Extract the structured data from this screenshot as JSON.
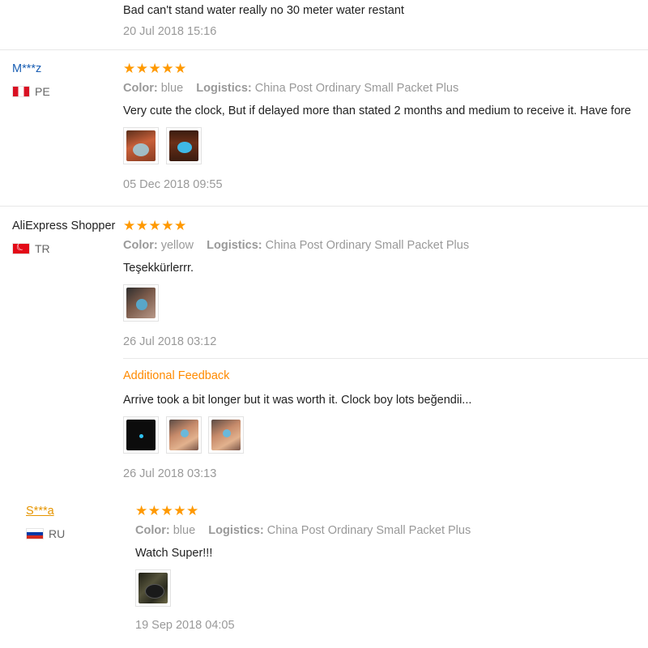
{
  "top_review": {
    "text": "Bad can't stand water really no 30 meter water restant",
    "date": "20 Jul 2018 15:16"
  },
  "reviews": [
    {
      "name": "M***z",
      "country_code": "PE",
      "stars": "★★★★★",
      "color_label": "Color:",
      "color_value": "blue",
      "logistics_label": "Logistics:",
      "logistics_value": "China Post Ordinary Small Packet Plus",
      "text": "Very cute the clock, But if delayed more than stated 2 months and medium to receive it. Have fore",
      "date": "05 Dec 2018 09:55"
    },
    {
      "name": "AliExpress Shopper",
      "country_code": "TR",
      "stars": "★★★★★",
      "color_label": "Color:",
      "color_value": "yellow",
      "logistics_label": "Logistics:",
      "logistics_value": "China Post Ordinary Small Packet Plus",
      "text": "Teşekkürlerrr.",
      "date": "26 Jul 2018 03:12",
      "additional_label": "Additional Feedback",
      "additional_text": "Arrive took a bit longer but it was worth it. Clock boy lots beğendii...",
      "additional_date": "26 Jul 2018 03:13"
    },
    {
      "name": "S***a",
      "country_code": "RU",
      "stars": "★★★★★",
      "color_label": "Color:",
      "color_value": "blue",
      "logistics_label": "Logistics:",
      "logistics_value": "China Post Ordinary Small Packet Plus",
      "text": "Watch Super!!!",
      "date": "19 Sep 2018 04:05"
    }
  ],
  "colors": {
    "star": "#ff9900",
    "additional": "#ff8a00",
    "name_link": "#1a5fb4",
    "meta": "#999999"
  }
}
